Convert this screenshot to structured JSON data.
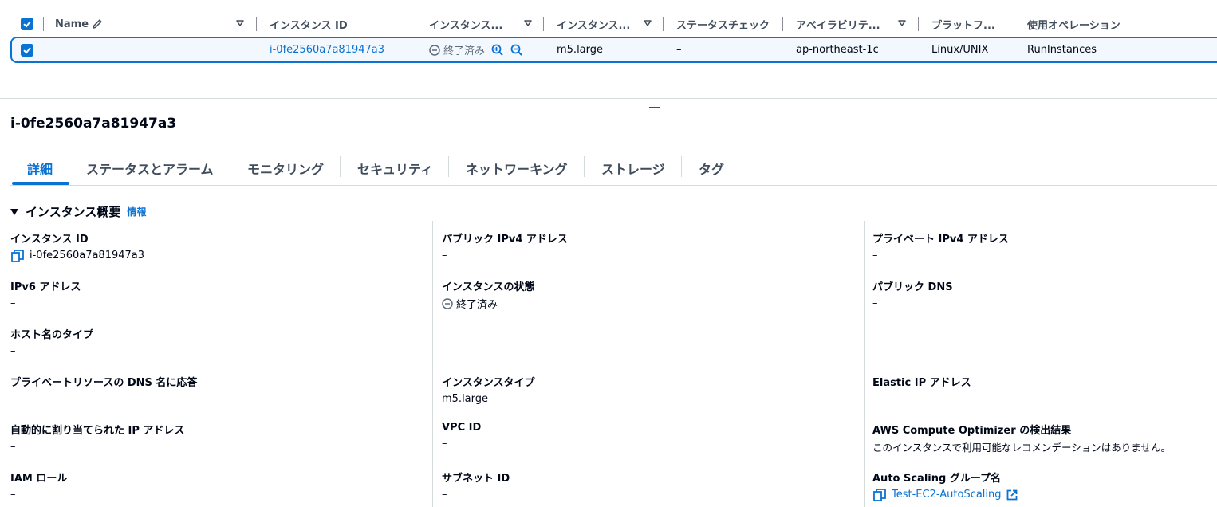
{
  "table": {
    "columns": [
      {
        "label": "Name"
      },
      {
        "label": "インスタンス ID"
      },
      {
        "label": "インスタンス..."
      },
      {
        "label": "インスタンス..."
      },
      {
        "label": "ステータスチェック"
      },
      {
        "label": "アベイラビリテ..."
      },
      {
        "label": "プラットフ..."
      },
      {
        "label": "使用オペレーション"
      }
    ],
    "row": {
      "instance_id": "i-0fe2560a7a81947a3",
      "state": "終了済み",
      "type": "m5.large",
      "status_check": "–",
      "az": "ap-northeast-1c",
      "platform": "Linux/UNIX",
      "operation": "RunInstances"
    }
  },
  "detail": {
    "title": "i-0fe2560a7a81947a3",
    "tabs": [
      "詳細",
      "ステータスとアラーム",
      "モニタリング",
      "セキュリティ",
      "ネットワーキング",
      "ストレージ",
      "タグ"
    ],
    "section_title": "インスタンス概要",
    "section_info": "情報",
    "col1": [
      {
        "key": "インスタンス ID",
        "value": "i-0fe2560a7a81947a3"
      },
      {
        "key": "IPv6 アドレス",
        "value": "–"
      },
      {
        "key": "ホスト名のタイプ",
        "value": "–"
      },
      {
        "key": "プライベートリソースの DNS 名に応答",
        "value": "–"
      },
      {
        "key": "自動的に割り当てられた IP アドレス",
        "value": "–"
      },
      {
        "key": "IAM ロール",
        "value": "–"
      }
    ],
    "col2": [
      {
        "key": "パブリック IPv4 アドレス",
        "value": "–"
      },
      {
        "key": "インスタンスの状態",
        "value": "終了済み"
      },
      {
        "key": "インスタンスタイプ",
        "value": "m5.large"
      },
      {
        "key": "VPC ID",
        "value": "–"
      },
      {
        "key": "サブネット ID",
        "value": "–"
      }
    ],
    "col3": [
      {
        "key": "プライベート IPv4 アドレス",
        "value": "–"
      },
      {
        "key": "パブリック DNS",
        "value": "–"
      },
      {
        "key": "Elastic IP アドレス",
        "value": "–"
      },
      {
        "key": "AWS Compute Optimizer の検出結果",
        "value": "このインスタンスで利用可能なレコメンデーションはありません。"
      },
      {
        "key": "Auto Scaling グループ名",
        "value": "Test-EC2-AutoScaling"
      }
    ]
  },
  "icons": {
    "checkbox": "check-icon",
    "name_edit": "pencil-icon",
    "sort": "caret-down-icon",
    "state": "minus-circle-icon",
    "zoom_in": "zoom-in-icon",
    "zoom_out": "zoom-out-icon",
    "copy": "copy-icon",
    "external": "external-link-icon"
  },
  "colors": {
    "accent": "#0972d3",
    "text": "#000716",
    "muted": "#5f6b7a",
    "selected_bg": "#f2f8fd"
  }
}
